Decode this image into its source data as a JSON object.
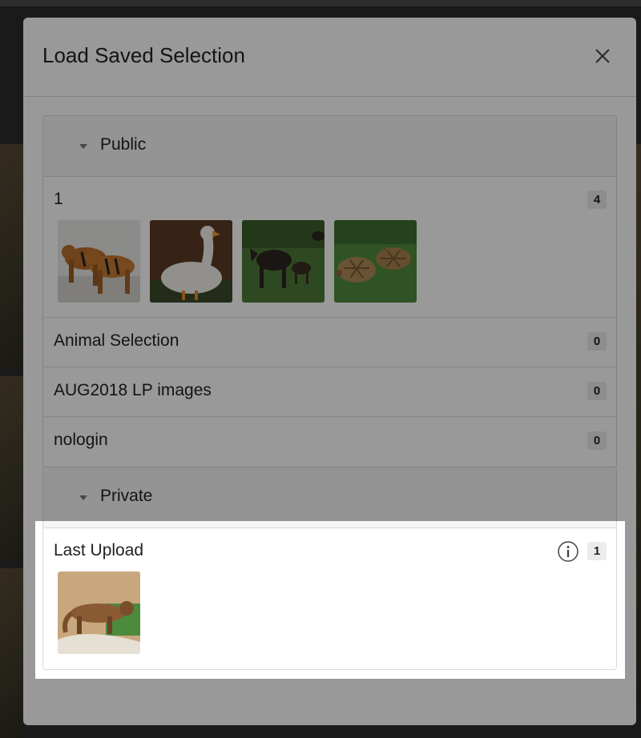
{
  "modal": {
    "title": "Load Saved Selection",
    "close_icon": "close-icon"
  },
  "public": {
    "label": "Public",
    "items": [
      {
        "name": "1",
        "count": "4",
        "thumbnails": [
          "tigers",
          "goose",
          "moose",
          "tortoises"
        ]
      },
      {
        "name": "Animal Selection",
        "count": "0"
      },
      {
        "name": "AUG2018 LP images",
        "count": "0"
      },
      {
        "name": "nologin",
        "count": "0"
      }
    ]
  },
  "private": {
    "label": "Private",
    "items": [
      {
        "name": "Last Upload",
        "count": "1",
        "info_icon": "info-icon",
        "thumbnails": [
          "marten"
        ]
      }
    ]
  },
  "colors": {
    "overlay": "#000000",
    "panel_header_bg": "#f7f7f7",
    "badge_bg": "#ececec"
  }
}
